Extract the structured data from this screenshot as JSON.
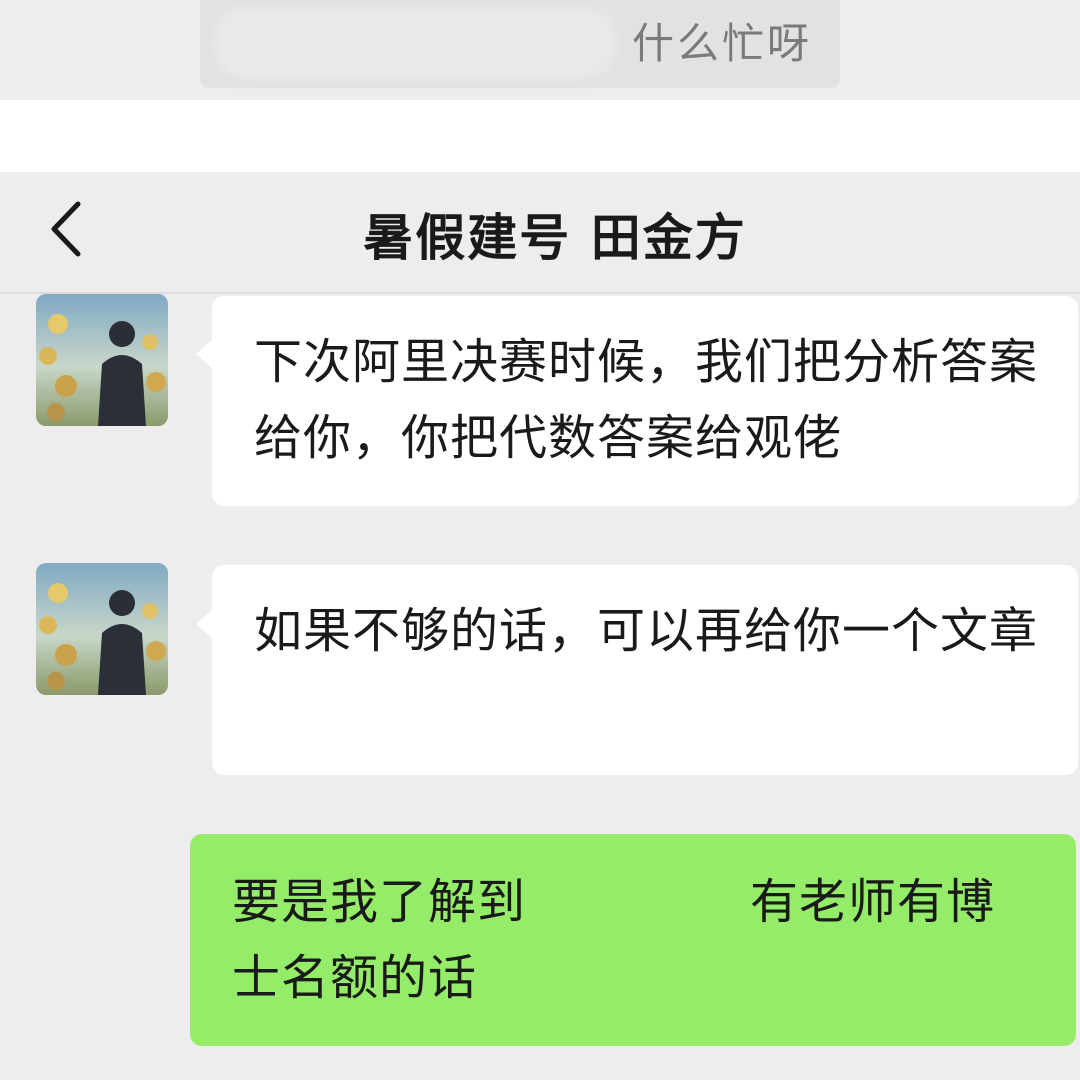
{
  "previous_message": {
    "text": "什么忙呀"
  },
  "header": {
    "title": "暑假建号 田金方",
    "back_icon": "chevron-left-icon"
  },
  "messages": [
    {
      "direction": "incoming",
      "avatar": "anime-avatar",
      "text": "下次阿里决赛时候，我们把分析答案给你，你把代数答案给观佬"
    },
    {
      "direction": "incoming",
      "avatar": "anime-avatar",
      "text": "如果不够的话，可以再给你一个文章"
    },
    {
      "direction": "outgoing",
      "text_part1": "要是我了解到",
      "text_part2": "有老师有博士名额的话"
    }
  ],
  "colors": {
    "background": "#ededed",
    "incoming_bubble": "#ffffff",
    "outgoing_bubble": "#95ec69"
  }
}
